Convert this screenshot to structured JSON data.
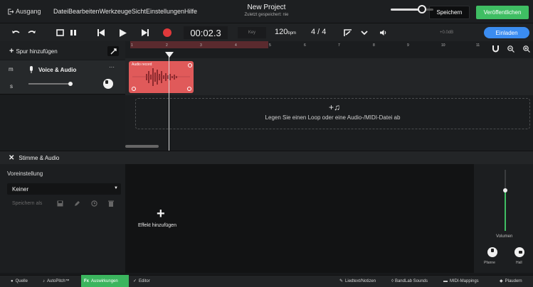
{
  "menubar": {
    "exit_label": "Ausgang",
    "menus": [
      "Datei",
      "Bearbeiten",
      "Werkzeuge",
      "Sicht",
      "Einstellungen",
      "Hilfe"
    ],
    "project_title": "New Project",
    "project_subtitle": "Zuletzt gespeichert: nie",
    "save_label": "Speichern",
    "publish_label": "Veröffentlichen"
  },
  "transport": {
    "time": "00:02.3",
    "key_label": "Key",
    "bpm_value": "120",
    "bpm_unit": "bpm",
    "signature": "4 / 4",
    "volume_db": "+0.0dB",
    "volume_level": 0.7,
    "invite_label": "Einladen"
  },
  "tracks": {
    "add_label": "Spur hinzufügen",
    "track_name": "Voice & Audio",
    "mute_label": "m",
    "solo_label": "s",
    "more_label": "···",
    "clip_label": "Audio record",
    "drop_text": "Legen Sie einen Loop oder eine Audio-/MIDI-Datei ab"
  },
  "ruler": {
    "ticks": [
      "1",
      "2",
      "3",
      "4",
      "5",
      "6",
      "7",
      "8",
      "9",
      "10",
      "11"
    ]
  },
  "fx_panel": {
    "title": "Stimme & Audio",
    "preset_label": "Voreinstellung",
    "preset_value": "Keiner",
    "save_as_label": "Speichern als",
    "add_effect_label": "Effekt hinzufügen",
    "volume_label": "Volumen",
    "pan_label": "Pfanne",
    "reverb_label": "Hall"
  },
  "bottombar": {
    "source": "Quelle",
    "autopitch": "AutoPitch™",
    "effects": "Auswirkungen",
    "editor": "Editor",
    "lyrics": "Liedtext/Notizen",
    "sounds": "BandLab Sounds",
    "midi": "MIDI-Mappings",
    "chat": "Plaudern"
  },
  "colors": {
    "accent_green": "#3fbe63",
    "accent_blue": "#3b8cf0",
    "clip_red": "#e05a5a",
    "record_red": "#e0393b"
  }
}
